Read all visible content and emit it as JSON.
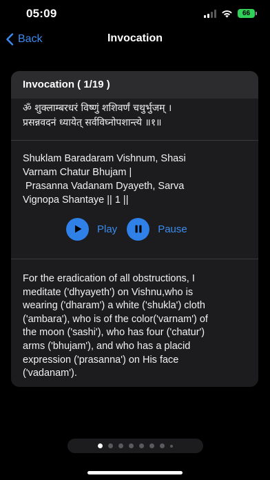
{
  "status": {
    "time": "05:09",
    "battery": "66",
    "battery_color": "#30d158"
  },
  "nav": {
    "back_label": "Back",
    "title": "Invocation"
  },
  "card": {
    "header": "Invocation ( 1/19 )",
    "sanskrit": [
      "ॐ शुक्लाम्बरधरं विष्णुं शशिवर्णं चथुर्भुजम् ।",
      "प्रसन्नवदनं ध्यायेत् सर्वविघ्नोपशान्त्ये ॥१॥"
    ],
    "transliteration": [
      "Shuklam Baradaram Vishnum, Shasi",
      "Varnam Chatur Bhujam |",
      " Prasanna Vadanam Dyayeth, Sarva",
      "Vignopa Shantaye || 1 ||"
    ],
    "play_label": "Play",
    "pause_label": "Pause",
    "description": [
      "For the eradication of all obstructions, I",
      "meditate ('dhyayeth') on Vishnu,who is",
      "wearing ('dharam') a white ('shukla') cloth",
      "('ambara'), who is of the color('varnam') of",
      "the moon ('sashi'), who has four ('chatur')",
      "arms ('bhujam'), and who has a placid",
      "expression ('prasanna') on His face",
      "('vadanam')."
    ]
  },
  "pager": {
    "current_page": 1,
    "visible_dots": 8
  },
  "colors": {
    "accent": "#3b8cf0",
    "button_fill": "#2f81e8",
    "card_bg": "#1c1c1e",
    "header_bg": "#2c2c2e"
  }
}
